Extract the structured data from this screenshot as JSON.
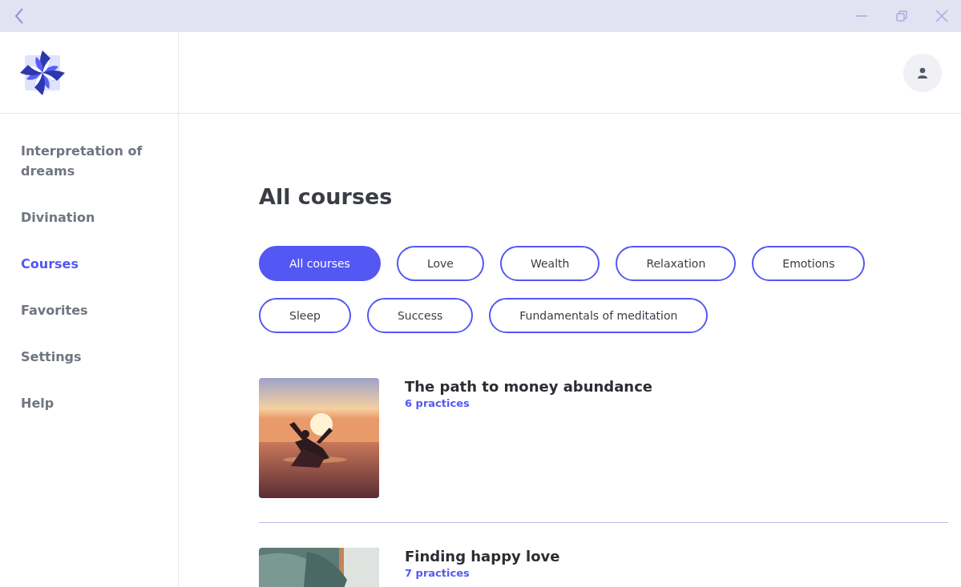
{
  "sidebar": {
    "items": [
      {
        "label": "Interpretation of dreams",
        "selected": false
      },
      {
        "label": "Divination",
        "selected": false
      },
      {
        "label": "Courses",
        "selected": true
      },
      {
        "label": "Favorites",
        "selected": false
      },
      {
        "label": "Settings",
        "selected": false
      },
      {
        "label": "Help",
        "selected": false
      }
    ]
  },
  "page_title": "All courses",
  "filters": [
    {
      "label": "All courses",
      "selected": true
    },
    {
      "label": "Love",
      "selected": false
    },
    {
      "label": "Wealth",
      "selected": false
    },
    {
      "label": "Relaxation",
      "selected": false
    },
    {
      "label": "Emotions",
      "selected": false
    },
    {
      "label": "Sleep",
      "selected": false
    },
    {
      "label": "Success",
      "selected": false
    },
    {
      "label": "Fundamentals of meditation",
      "selected": false
    }
  ],
  "courses": [
    {
      "title": "The path to money abundance",
      "practices": "6 practices"
    },
    {
      "title": "Finding happy love",
      "practices": "7 practices"
    }
  ]
}
